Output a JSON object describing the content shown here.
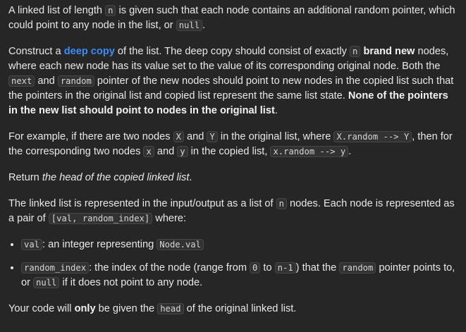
{
  "p1": {
    "t1": "A linked list of length ",
    "c1": "n",
    "t2": " is given such that each node contains an additional random pointer, which could point to any node in the list, or ",
    "c2": "null",
    "t3": "."
  },
  "p2": {
    "t1": "Construct a ",
    "link": "deep copy",
    "t2": " of the list. The deep copy should consist of exactly ",
    "c1": "n",
    "t3": " ",
    "b1": "brand new",
    "t4": " nodes, where each new node has its value set to the value of its corresponding original node. Both the ",
    "c2": "next",
    "t5": " and ",
    "c3": "random",
    "t6": " pointer of the new nodes should point to new nodes in the copied list such that the pointers in the original list and copied list represent the same list state. ",
    "b2": "None of the pointers in the new list should point to nodes in the original list",
    "t7": "."
  },
  "p3": {
    "t1": "For example, if there are two nodes ",
    "c1": "X",
    "t2": " and ",
    "c2": "Y",
    "t3": " in the original list, where ",
    "c3": "X.random --> Y",
    "t4": ", then for the corresponding two nodes ",
    "c4": "x",
    "t5": " and ",
    "c5": "y",
    "t6": " in the copied list, ",
    "c6": "x.random --> y",
    "t7": "."
  },
  "p4": {
    "t1": "Return ",
    "e1": "the head of the copied linked list",
    "t2": "."
  },
  "p5": {
    "t1": "The linked list is represented in the input/output as a list of ",
    "c1": "n",
    "t2": " nodes. Each node is represented as a pair of ",
    "c2": "[val, random_index]",
    "t3": " where:"
  },
  "list": {
    "i1": {
      "c1": "val",
      "t1": ": an integer representing ",
      "c2": "Node.val"
    },
    "i2": {
      "c1": "random_index",
      "t1": ": the index of the node (range from ",
      "c2": "0",
      "t2": " to ",
      "c3": "n-1",
      "t3": ") that the ",
      "c4": "random",
      "t4": " pointer points to, or ",
      "c5": "null",
      "t5": " if it does not point to any node."
    }
  },
  "p6": {
    "t1": "Your code will ",
    "b1": "only",
    "t2": " be given the ",
    "c1": "head",
    "t3": " of the original linked list."
  }
}
